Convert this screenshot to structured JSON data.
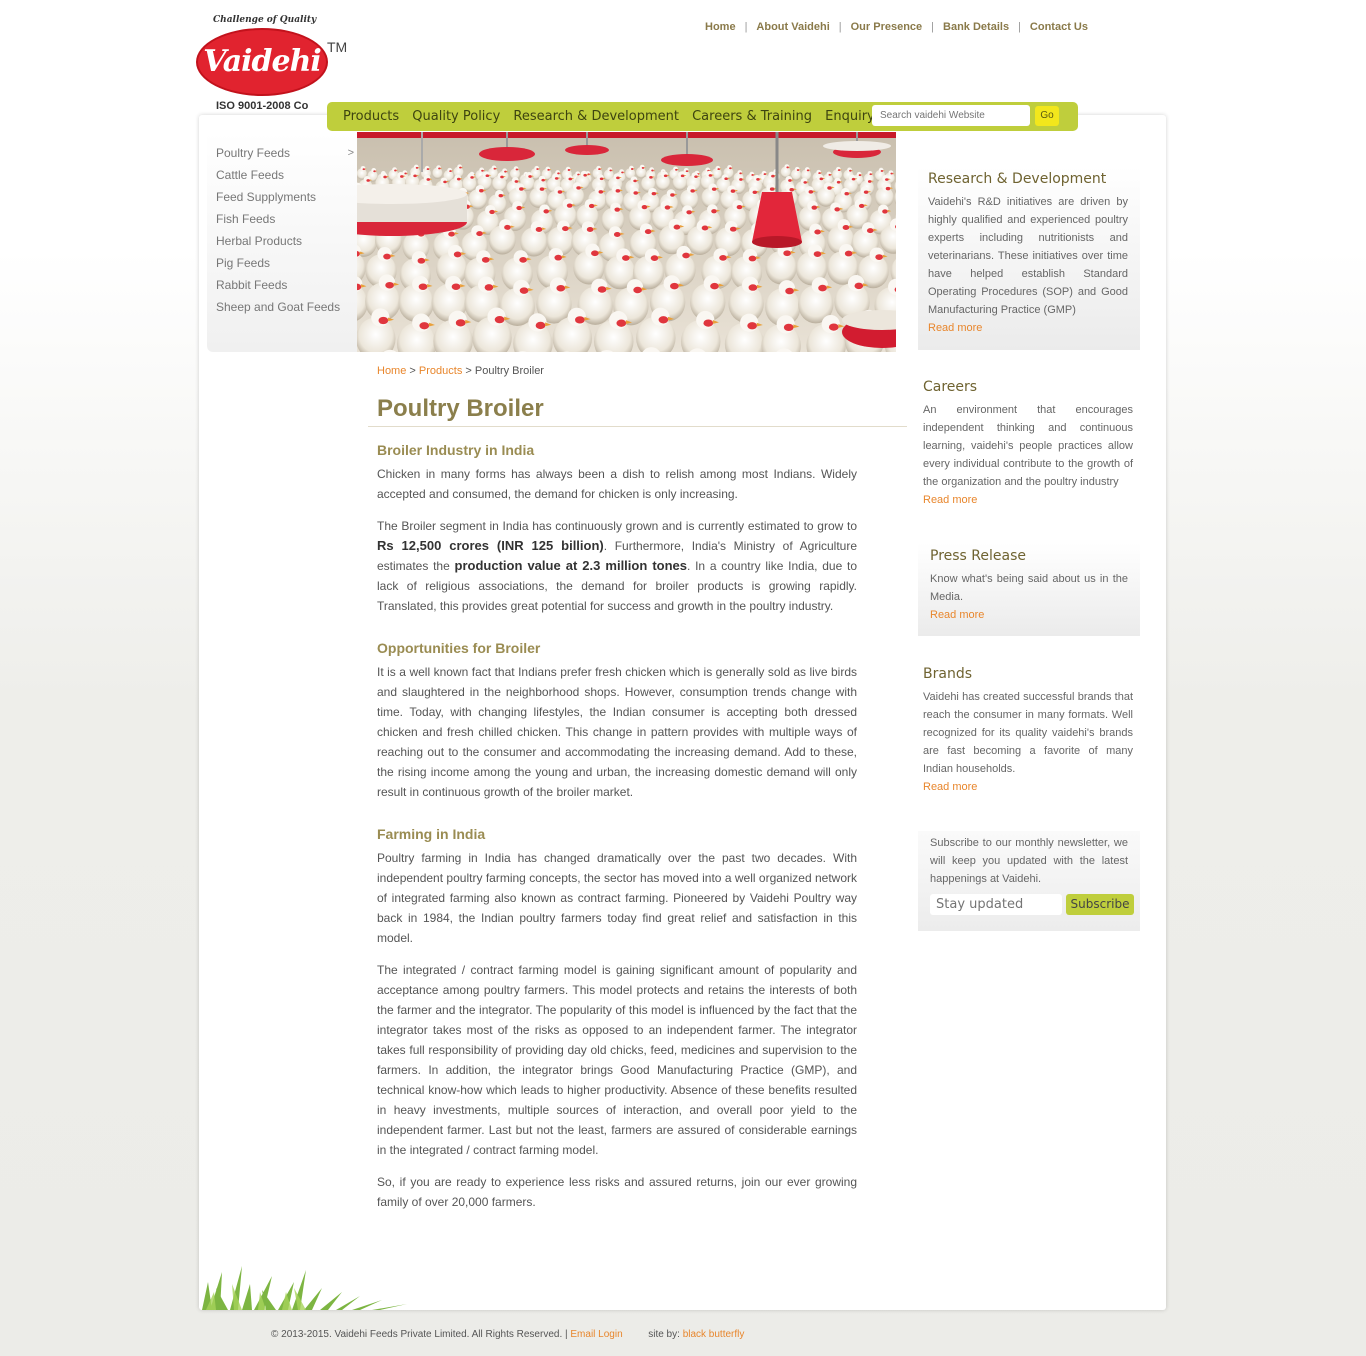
{
  "logo": {
    "tagline": "Challenge of Quality",
    "wordmark": "Vaidehi",
    "tm": "TM",
    "iso": "ISO 9001-2008 Co"
  },
  "top_nav": [
    "Home",
    "About Vaidehi",
    "Our Presence",
    "Bank Details",
    "Contact Us"
  ],
  "main_nav": [
    "Products",
    "Quality Policy",
    "Research & Development",
    "Careers & Training",
    "Enquiry"
  ],
  "search": {
    "placeholder": "Search vaidehi Website",
    "go": "Go"
  },
  "sidebar": {
    "items": [
      "Poultry Feeds",
      "Cattle Feeds",
      "Feed Supplyments",
      "Fish Feeds",
      "Herbal Products",
      "Pig Feeds",
      "Rabbit Feeds",
      "Sheep and Goat Feeds"
    ],
    "arrow": ">"
  },
  "breadcrumb": {
    "home": "Home",
    "sep": ">",
    "products": "Products",
    "current": "Poultry Broiler"
  },
  "title": "Poultry Broiler",
  "sections": {
    "s1_heading": "Broiler Industry in India",
    "s1_p1": "Chicken in many forms has always been a dish to relish among most Indians. Widely accepted and consumed, the demand for chicken is only increasing.",
    "s1_p2_a": "The Broiler segment in India has continuously grown and is currently estimated to grow to ",
    "s1_p2_b": "Rs 12,500 crores (INR 125 billion)",
    "s1_p2_c": ". Furthermore, India's Ministry of Agriculture estimates the ",
    "s1_p2_d": "production value at 2.3 million tones",
    "s1_p2_e": ". In a country like India, due to lack of religious associations, the demand for broiler products is growing rapidly. Translated, this provides great potential for success and growth in the poultry industry.",
    "s2_heading": "Opportunities for Broiler",
    "s2_p1": "It is a well known fact that Indians prefer fresh chicken which is generally sold as live birds and slaughtered in the neighborhood shops. However, consumption trends change with time. Today, with changing lifestyles, the Indian consumer is accepting both dressed chicken and fresh chilled chicken. This change in pattern provides with multiple ways of reaching out to the consumer and accommodating the increasing demand. Add to these, the rising income among the young and urban, the increasing domestic demand will only result in continuous growth of the broiler market.",
    "s3_heading": "Farming in India",
    "s3_p1": "Poultry farming in India has changed dramatically over the past two decades. With independent poultry farming concepts, the sector has moved into a well organized network of integrated farming also known as contract farming. Pioneered by Vaidehi Poultry way back in 1984, the Indian poultry farmers today find great relief and satisfaction in this model.",
    "s3_p2": "The integrated / contract farming model is gaining significant amount of popularity and acceptance among poultry farmers. This model protects and retains the interests of both the farmer and the integrator. The popularity of this model is influenced by the fact that the integrator takes most of the risks as opposed to an independent farmer. The integrator takes full responsibility of providing day old chicks, feed, medicines and supervision to the farmers. In addition, the integrator brings Good Manufacturing Practice (GMP), and technical know-how which leads to higher productivity. Absence of these benefits resulted in heavy investments, multiple sources of interaction, and overall poor yield to the independent farmer. Last but not the least, farmers are assured of considerable earnings in the integrated / contract farming model.",
    "s3_p3": "So, if you are ready to experience less risks and assured returns, join our ever growing family of over 20,000 farmers."
  },
  "right": {
    "rd": {
      "title": "Research & Development",
      "text": "Vaidehi's R&D initiatives are driven by highly qualified and experienced poultry experts including nutritionists and veterinarians. These initiatives over time have helped establish Standard Operating Procedures (SOP) and Good Manufacturing Practice (GMP)",
      "more": "Read more"
    },
    "careers": {
      "title": "Careers",
      "text": "An environment that encourages independent thinking and continuous learning, vaidehi's people practices allow every individual contribute to the growth of the organization and the poultry industry",
      "more": "Read more"
    },
    "press": {
      "title": "Press Release",
      "text": "Know what's being said about us in the Media.",
      "more": "Read more"
    },
    "brands": {
      "title": "Brands",
      "text": "Vaidehi has created successful brands that reach the consumer in many formats. Well recognized for its quality vaidehi's brands are fast becoming a favorite of many Indian households.",
      "more": "Read more"
    },
    "newsletter": {
      "text": "Subscribe to our monthly newsletter, we will keep you updated with the latest happenings at Vaidehi.",
      "placeholder": "Stay updated",
      "button": "Subscribe"
    }
  },
  "footer": {
    "copyright": "© 2013-2015. Vaidehi Feeds Private Limited. All Rights Reserved. |",
    "email_login": "Email Login",
    "site_by": "site by:",
    "designer": "black butterfly"
  },
  "colors": {
    "accent_green": "#bfce3c",
    "link_orange": "#e8862c",
    "heading_olive": "#8b7f4c",
    "logo_red": "#e1232f"
  }
}
